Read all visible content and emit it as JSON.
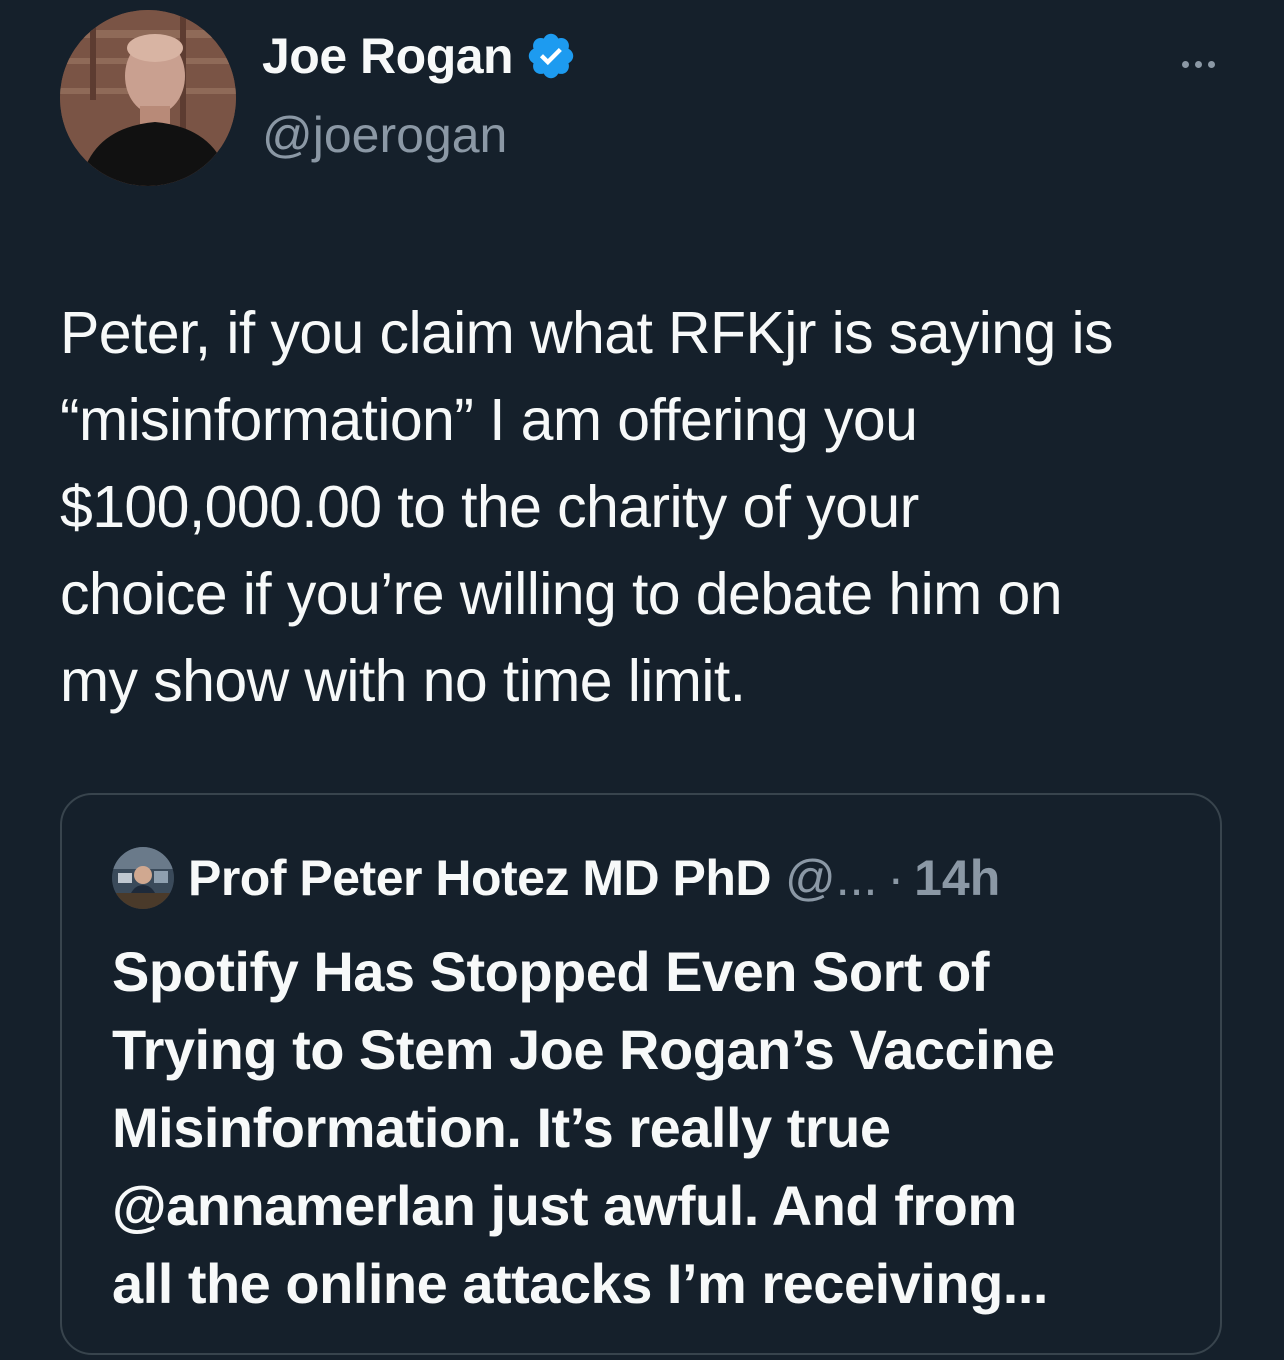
{
  "tweet": {
    "author": {
      "name": "Joe Rogan",
      "handle": "@joerogan",
      "verified": true,
      "avatar_icon": "profile-photo"
    },
    "more_icon": "more-dots-icon",
    "text": "Peter, if you claim what RFKjr is saying is\n“misinformation” I am offering you\n$100,000.00 to the charity of your\nchoice if you’re willing to debate him on\nmy show with no time limit."
  },
  "quote": {
    "author": {
      "name": "Prof Peter Hotez MD PhD",
      "handle": "@...",
      "avatar_icon": "profile-photo"
    },
    "separator": "·",
    "time": "14h",
    "text": "Spotify Has Stopped Even Sort of\nTrying to Stem Joe Rogan’s Vaccine\nMisinformation. It’s really true\n@annamerlan just awful. And from\nall the online attacks I’m receiving..."
  },
  "colors": {
    "background": "#15202b",
    "text_primary": "#f7f9f9",
    "text_secondary": "#8b98a5",
    "verified_blue": "#1d9bf0",
    "border": "#38444d"
  }
}
